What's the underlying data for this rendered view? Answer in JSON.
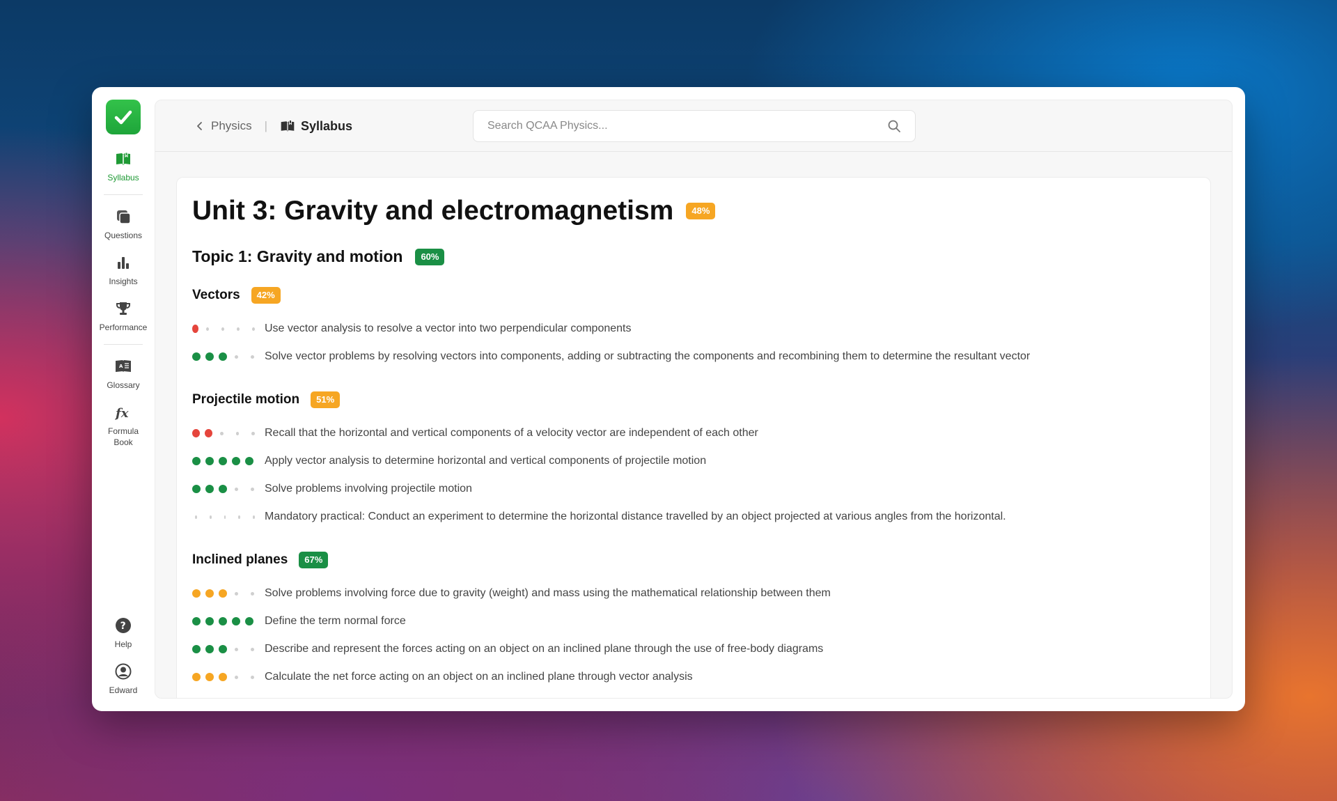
{
  "colors": {
    "green": "#1a8f45",
    "orange": "#f6a623",
    "red": "#e5453c",
    "accent": "#1f9a35"
  },
  "sidebar": {
    "items": [
      {
        "id": "syllabus",
        "label": "Syllabus",
        "icon": "open-book-icon",
        "active": true
      },
      {
        "id": "questions",
        "label": "Questions",
        "icon": "cards-icon"
      },
      {
        "id": "insights",
        "label": "Insights",
        "icon": "bar-chart-icon"
      },
      {
        "id": "performance",
        "label": "Performance",
        "icon": "trophy-icon"
      },
      {
        "id": "glossary",
        "label": "Glossary",
        "icon": "glossary-book-icon"
      },
      {
        "id": "formula",
        "label": "Formula Book",
        "icon": "function-icon"
      }
    ],
    "bottom": [
      {
        "id": "help",
        "label": "Help",
        "icon": "help-icon"
      },
      {
        "id": "user",
        "label": "Edward",
        "icon": "user-icon"
      }
    ]
  },
  "header": {
    "back_label": "Physics",
    "current": "Syllabus",
    "search_placeholder": "Search QCAA Physics..."
  },
  "unit": {
    "title": "Unit 3: Gravity and electromagnetism",
    "badge": "48%",
    "badge_color": "orange"
  },
  "topic": {
    "title": "Topic 1: Gravity and motion",
    "badge": "60%",
    "badge_color": "green"
  },
  "sections": [
    {
      "title": "Vectors",
      "badge": "42%",
      "badge_color": "orange",
      "items": [
        {
          "filled": 1,
          "color": "red",
          "text": "Use vector analysis to resolve a vector into two perpendicular components"
        },
        {
          "filled": 3,
          "color": "green",
          "text": "Solve vector problems by resolving vectors into components, adding or subtracting the components and recombining them to determine the resultant vector"
        }
      ]
    },
    {
      "title": "Projectile motion",
      "badge": "51%",
      "badge_color": "orange",
      "items": [
        {
          "filled": 2,
          "color": "red",
          "text": "Recall that the horizontal and vertical components of a velocity vector are independent of each other"
        },
        {
          "filled": 5,
          "color": "green",
          "text": "Apply vector analysis to determine horizontal and vertical components of projectile motion"
        },
        {
          "filled": 3,
          "color": "green",
          "text": "Solve problems involving projectile motion"
        },
        {
          "filled": 0,
          "color": "green",
          "text": "Mandatory practical: Conduct an experiment to determine the horizontal distance travelled by an object projected at various angles from the horizontal."
        }
      ]
    },
    {
      "title": "Inclined planes",
      "badge": "67%",
      "badge_color": "green",
      "items": [
        {
          "filled": 3,
          "color": "orange",
          "text": "Solve problems involving force due to gravity (weight) and mass using the mathematical relationship between them"
        },
        {
          "filled": 5,
          "color": "green",
          "text": "Define the term normal force"
        },
        {
          "filled": 3,
          "color": "green",
          "text": "Describe and represent the forces acting on an object on an inclined plane through the use of free-body diagrams"
        },
        {
          "filled": 3,
          "color": "orange",
          "text": "Calculate the net force acting on an object on an inclined plane through vector analysis"
        }
      ]
    }
  ]
}
